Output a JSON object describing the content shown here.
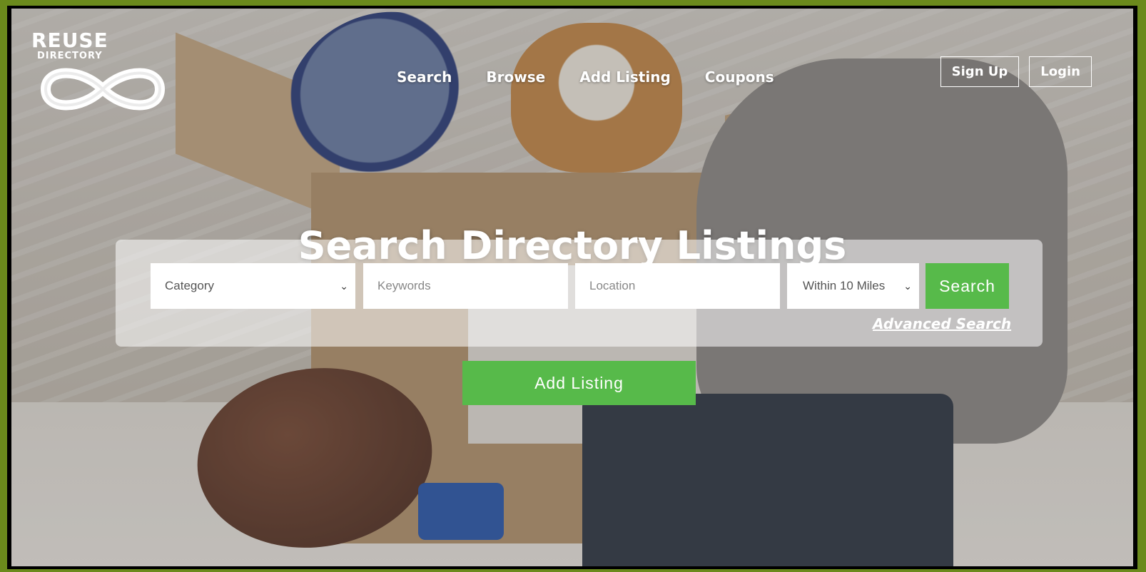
{
  "brand": {
    "logo_title": "REUSE",
    "logo_subtitle": "DIRECTORY"
  },
  "nav": {
    "items": [
      "Search",
      "Browse",
      "Add Listing",
      "Coupons"
    ]
  },
  "auth": {
    "signup": "Sign Up",
    "login": "Login"
  },
  "hero": {
    "title": "Search Directory Listings"
  },
  "search_form": {
    "category": {
      "selected": "Category"
    },
    "keywords": {
      "placeholder": "Keywords"
    },
    "location": {
      "placeholder": "Location"
    },
    "radius": {
      "selected": "Within 10 Miles"
    },
    "submit_label": "Search",
    "advanced_link": "Advanced Search"
  },
  "cta": {
    "add_listing_label": "Add Listing"
  },
  "colors": {
    "accent_green": "#57ba4a",
    "frame_green": "#6b8a1c"
  },
  "icons": {
    "select_chevron": "chevron-down-icon",
    "logo_symbol": "infinity-icon"
  }
}
